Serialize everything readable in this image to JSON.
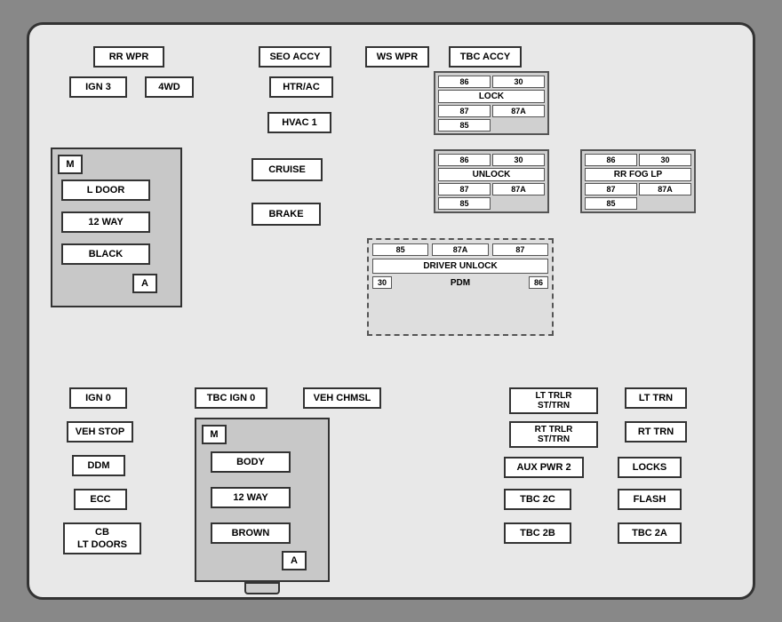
{
  "labels": {
    "rr_wpr": "RR WPR",
    "seo_accy": "SEO ACCY",
    "ws_wpr": "WS WPR",
    "tbc_accy": "TBC ACCY",
    "ign3": "IGN 3",
    "fwd": "4WD",
    "htr_ac": "HTR/AC",
    "hvac1": "HVAC 1",
    "cruise": "CRUISE",
    "brake": "BRAKE",
    "ign0": "IGN 0",
    "tbc_ign0": "TBC IGN 0",
    "veh_chmsl": "VEH CHMSL",
    "veh_stop": "VEH STOP",
    "ddm": "DDM",
    "ecc": "ECC",
    "cb_lt_doors": "CB\nLT DOORS",
    "lt_trlr": "LT TRLR\nST/TRN",
    "lt_trn": "LT TRN",
    "rt_trlr": "RT TRLR\nST/TRN",
    "rt_trn": "RT TRN",
    "aux_pwr2": "AUX PWR 2",
    "locks": "LOCKS",
    "tbc_2c": "TBC 2C",
    "flash": "FLASH",
    "tbc_2b": "TBC 2B",
    "tbc_2a": "TBC 2A",
    "pdm": "PDM",
    "lock": "LOCK",
    "unlock": "UNLOCK",
    "rr_fog_lp": "RR FOG LP",
    "driver_unlock": "DRIVER UNLOCK",
    "l_door": "L DOOR",
    "way12": "12 WAY",
    "black": "BLACK",
    "body": "BODY",
    "way12b": "12 WAY",
    "brown": "BROWN",
    "m_top": "M",
    "a_top": "A",
    "m_bot": "M",
    "a_bot": "A",
    "r86_lock": "86",
    "r30_lock": "30",
    "r87_lock": "87",
    "r87a_lock": "87A",
    "r85_lock": "85",
    "r86_unlock": "86",
    "r30_unlock": "30",
    "r87_unlock": "87",
    "r87a_unlock": "87A",
    "r85_unlock": "85",
    "r86_fog": "86",
    "r30_fog": "30",
    "r87_fog": "87",
    "r87a_fog": "87A",
    "r85_fog": "85",
    "r85_du": "85",
    "r87a_du": "87A",
    "r87_du": "87",
    "r30_du": "30",
    "r86_du": "86"
  }
}
